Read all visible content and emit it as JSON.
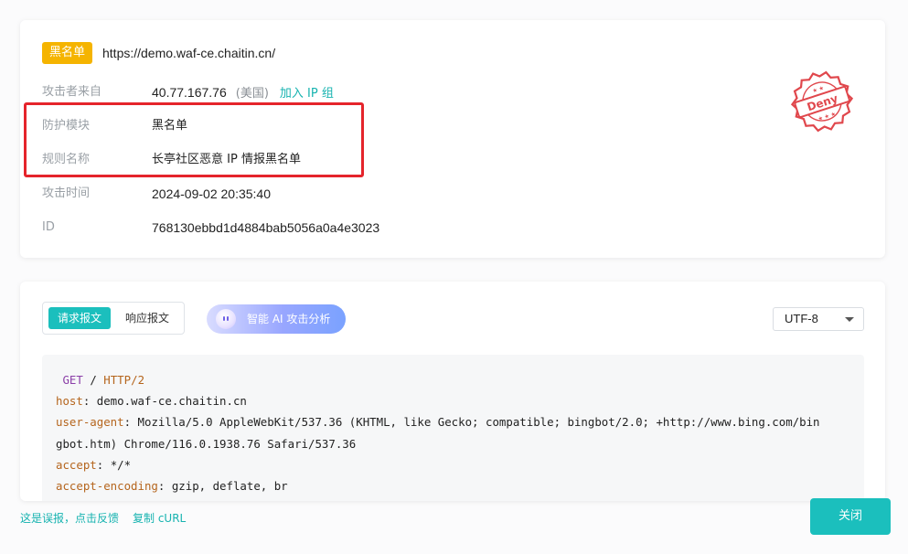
{
  "info": {
    "badge": "黑名单",
    "url": "https://demo.waf-ce.chaitin.cn/",
    "rows": [
      {
        "label": "攻击者来自",
        "value": "40.77.167.76",
        "country": "(美国)",
        "action": "加入 IP 组"
      },
      {
        "label": "防护模块",
        "value": "黑名单"
      },
      {
        "label": "规则名称",
        "value": "长亭社区恶意 IP 情报黑名单"
      },
      {
        "label": "攻击时间",
        "value": "2024-09-02 20:35:40"
      },
      {
        "label": "ID",
        "value": "768130ebbd1d4884bab5056a0a4e3023"
      }
    ],
    "stamp_text": "Deny",
    "highlight_color": "#e5242b"
  },
  "request": {
    "tabs": [
      {
        "label": "请求报文",
        "active": true
      },
      {
        "label": "响应报文",
        "active": false
      }
    ],
    "ai_button": "智能 AI 攻击分析",
    "encoding": "UTF-8",
    "first_line": {
      "method": "GET",
      "sep": "/",
      "protocol": "HTTP/2"
    },
    "headers": [
      {
        "key": "host",
        "value": "demo.waf-ce.chaitin.cn"
      },
      {
        "key": "user-agent",
        "value": "Mozilla/5.0 AppleWebKit/537.36 (KHTML, like Gecko; compatible; bingbot/2.0; +http://www.bing.com/bin"
      },
      {
        "key": "",
        "value": "gbot.htm) Chrome/116.0.1938.76 Safari/537.36"
      },
      {
        "key": "accept",
        "value": "*/*"
      },
      {
        "key": "accept-encoding",
        "value": "gzip, deflate, br"
      }
    ]
  },
  "footer": {
    "feedback": "这是误报，点击反馈",
    "copy_curl": "复制 cURL",
    "close": "关闭"
  },
  "colors": {
    "accent": "#1bbfbd",
    "badge": "#f5b400",
    "stamp": "#e0474c"
  }
}
